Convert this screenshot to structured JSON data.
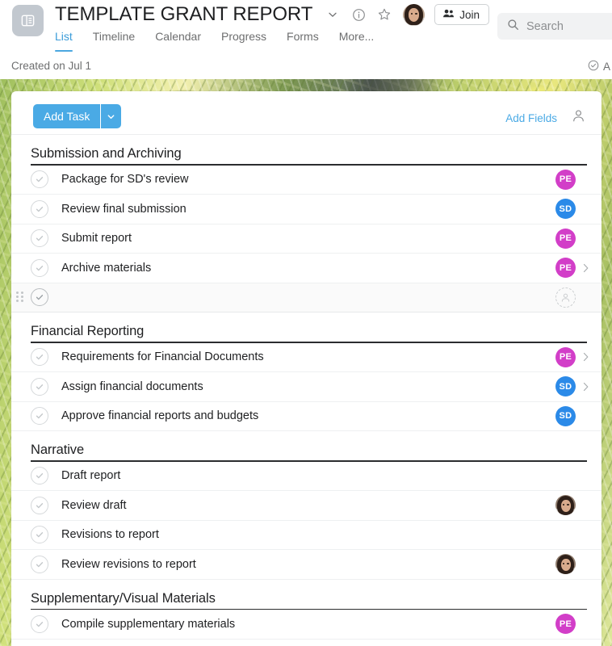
{
  "header": {
    "app_icon": "list-board-icon",
    "title": "TEMPLATE GRANT REPORT",
    "dropdown_icon": "chevron-down-icon",
    "info_icon": "info-circle-icon",
    "star_icon": "star-icon",
    "avatar_icon": "user-avatar",
    "join_label": "Join",
    "join_icon": "people-icon",
    "tabs": [
      {
        "label": "List",
        "active": true
      },
      {
        "label": "Timeline",
        "active": false
      },
      {
        "label": "Calendar",
        "active": false
      },
      {
        "label": "Progress",
        "active": false
      },
      {
        "label": "Forms",
        "active": false
      },
      {
        "label": "More...",
        "active": false
      }
    ],
    "search": {
      "placeholder": "Search",
      "icon": "search-icon"
    }
  },
  "subbar": {
    "created_text": "Created on Jul 1",
    "right_icon": "check-circle-icon",
    "right_text": "A"
  },
  "toolbar": {
    "add_task_label": "Add Task",
    "add_task_dropdown_icon": "chevron-down-icon",
    "add_fields_label": "Add Fields",
    "person_icon": "person-outline-icon"
  },
  "colors": {
    "accent_blue": "#4aaae5",
    "avatar_pe": "#d23ec8",
    "avatar_sd": "#2b8ae8",
    "section_rule": "#2b2d2f"
  },
  "sections": [
    {
      "title": "Submission and Archiving",
      "tasks": [
        {
          "name": "Package for SD's review",
          "assignee": "PE",
          "assignee_type": "initials",
          "chevron": false,
          "drag": false
        },
        {
          "name": "Review final submission",
          "assignee": "SD",
          "assignee_type": "initials",
          "chevron": false,
          "drag": false
        },
        {
          "name": "Submit report",
          "assignee": "PE",
          "assignee_type": "initials",
          "chevron": false,
          "drag": false
        },
        {
          "name": "Archive materials",
          "assignee": "PE",
          "assignee_type": "initials",
          "chevron": true,
          "drag": false
        },
        {
          "name": "",
          "assignee": "",
          "assignee_type": "ghost",
          "chevron": false,
          "drag": true
        }
      ]
    },
    {
      "title": "Financial Reporting",
      "tasks": [
        {
          "name": "Requirements for Financial Documents",
          "assignee": "PE",
          "assignee_type": "initials",
          "chevron": true,
          "drag": false
        },
        {
          "name": "Assign financial documents",
          "assignee": "SD",
          "assignee_type": "initials",
          "chevron": true,
          "drag": false
        },
        {
          "name": "Approve financial reports and budgets",
          "assignee": "SD",
          "assignee_type": "initials",
          "chevron": false,
          "drag": false
        }
      ]
    },
    {
      "title": "Narrative",
      "tasks": [
        {
          "name": "Draft report",
          "assignee": "",
          "assignee_type": "none",
          "chevron": false,
          "drag": false
        },
        {
          "name": "Review draft",
          "assignee": "",
          "assignee_type": "photo",
          "chevron": false,
          "drag": false
        },
        {
          "name": "Revisions to report",
          "assignee": "",
          "assignee_type": "none",
          "chevron": false,
          "drag": false
        },
        {
          "name": "Review revisions to report",
          "assignee": "",
          "assignee_type": "photo",
          "chevron": false,
          "drag": false
        }
      ]
    },
    {
      "title": "Supplementary/Visual Materials",
      "tasks": [
        {
          "name": "Compile supplementary materials",
          "assignee": "PE",
          "assignee_type": "initials",
          "chevron": false,
          "drag": false
        }
      ]
    }
  ]
}
